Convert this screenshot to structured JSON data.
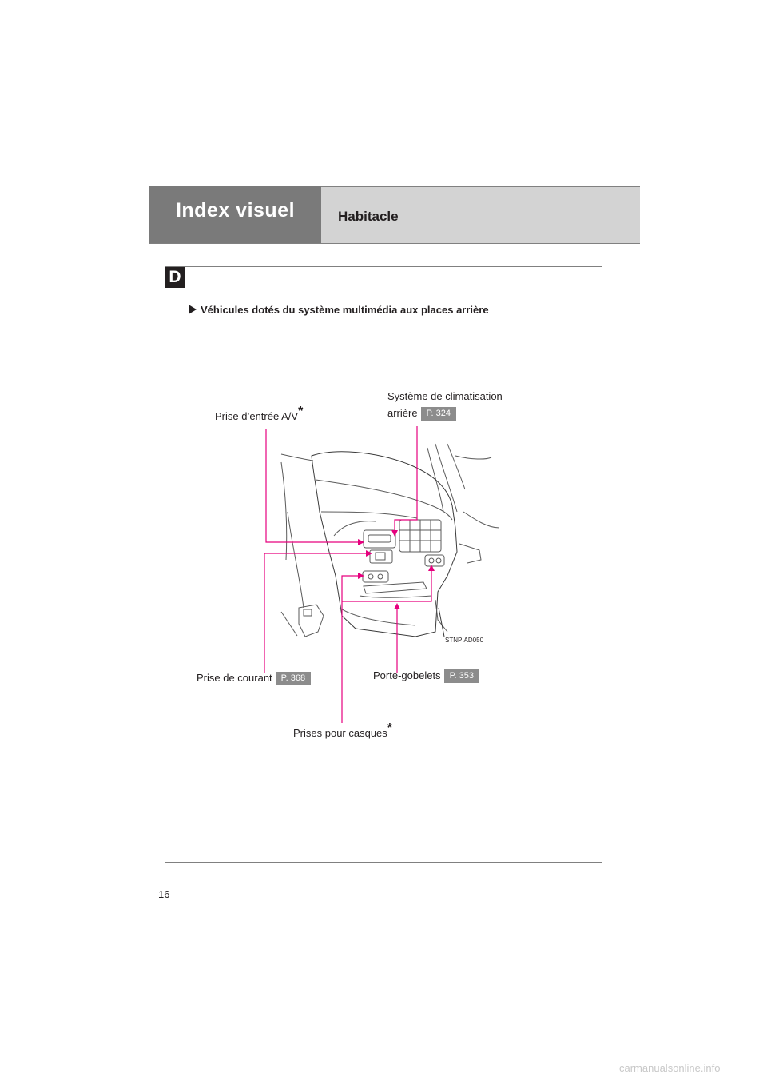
{
  "header": {
    "section_title": "Index visuel",
    "page_title": "Habitacle"
  },
  "section_badge": "D",
  "subtitle": "Véhicules dotés du système multimédia aux places arrière",
  "callouts": {
    "av_input": {
      "label": "Prise d’entrée A/V",
      "mark": "*"
    },
    "rear_climate": {
      "label_line1": "Système de climatisation",
      "label_line2": "arrière",
      "ref": "P. 324"
    },
    "power_outlet": {
      "label": "Prise de courant",
      "ref": "P. 368"
    },
    "cup_holders": {
      "label": "Porte-gobelets",
      "ref": "P. 353"
    },
    "headphone_jacks": {
      "label": "Prises pour casques",
      "mark": "*"
    }
  },
  "image_code": "STNPIAD050",
  "page_number": "16",
  "watermark": "carmanualsonline.info",
  "colors": {
    "leader_lines": "#e6007e",
    "header_dark": "#7a7a7a",
    "header_light": "#d3d3d3",
    "ref_box": "#8c8c8c"
  }
}
